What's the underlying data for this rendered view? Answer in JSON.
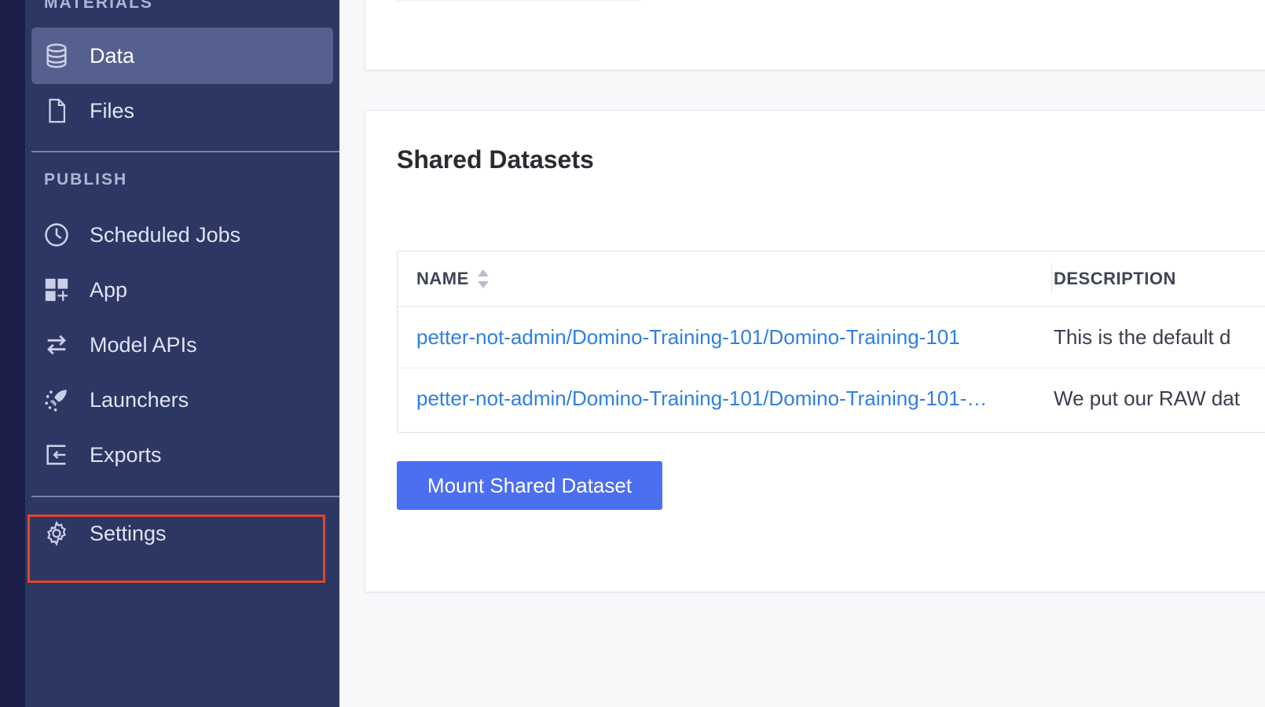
{
  "sidebar": {
    "materials_label": "MATERIALS",
    "publish_label": "PUBLISH",
    "items": [
      {
        "label": "Data",
        "icon": "database-icon",
        "active": true
      },
      {
        "label": "Files",
        "icon": "file-icon"
      },
      {
        "label": "Scheduled Jobs",
        "icon": "clock-icon"
      },
      {
        "label": "App",
        "icon": "app-grid-icon"
      },
      {
        "label": "Model APIs",
        "icon": "swap-arrows-icon"
      },
      {
        "label": "Launchers",
        "icon": "rocket-icon"
      },
      {
        "label": "Exports",
        "icon": "export-icon"
      },
      {
        "label": "Settings",
        "icon": "gear-icon"
      }
    ]
  },
  "shared_datasets": {
    "title": "Shared Datasets",
    "columns": [
      "NAME",
      "DESCRIPTION"
    ],
    "rows": [
      {
        "name": "petter-not-admin/Domino-Training-101/Domino-Training-101",
        "description": "This is the default d"
      },
      {
        "name": "petter-not-admin/Domino-Training-101/Domino-Training-101-…",
        "description": "We put our RAW dat"
      }
    ],
    "mount_button": "Mount Shared Dataset"
  },
  "colors": {
    "sidebar_bg": "#2d3763",
    "active_item_bg": "#55608f",
    "link": "#2f7fe3",
    "primary_button": "#4c6ef0",
    "highlight_border": "#e0452b"
  }
}
